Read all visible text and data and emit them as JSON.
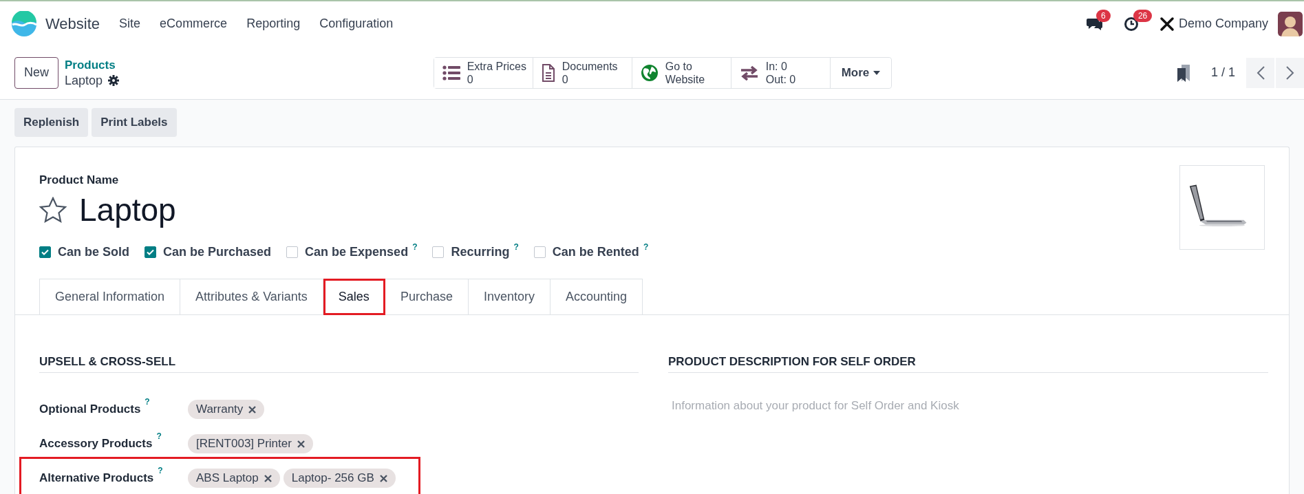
{
  "navbar": {
    "app_name": "Website",
    "menus": [
      "Site",
      "eCommerce",
      "Reporting",
      "Configuration"
    ],
    "messages_count": "6",
    "activities_count": "26",
    "company": "Demo Company"
  },
  "control_panel": {
    "new_button": "New",
    "breadcrumb": {
      "parent": "Products",
      "current": "Laptop"
    },
    "stat_buttons": [
      {
        "kind": "list",
        "lines": [
          "Extra Prices",
          "0"
        ]
      },
      {
        "kind": "document",
        "lines": [
          "Documents",
          "0"
        ]
      },
      {
        "kind": "globe",
        "lines": [
          "Go to",
          "Website"
        ]
      },
      {
        "kind": "transfer",
        "lines": [
          "In: 0",
          "Out: 0"
        ]
      }
    ],
    "more_button": "More",
    "pager": "1 / 1"
  },
  "action_buttons": [
    "Replenish",
    "Print Labels"
  ],
  "form": {
    "name_label": "Product Name",
    "name": "Laptop",
    "favorite": false,
    "options": [
      {
        "label": "Can be Sold",
        "checked": true
      },
      {
        "label": "Can be Purchased",
        "checked": true
      },
      {
        "label": "Can be Expensed",
        "checked": false,
        "help": "?"
      },
      {
        "label": "Recurring",
        "checked": false,
        "help": "?"
      },
      {
        "label": "Can be Rented",
        "checked": false,
        "help": "?"
      }
    ],
    "tabs": [
      {
        "label": "General Information",
        "selected": false,
        "highlighted": false
      },
      {
        "label": "Attributes & Variants",
        "selected": false,
        "highlighted": false
      },
      {
        "label": "Sales",
        "selected": true,
        "highlighted": true
      },
      {
        "label": "Purchase",
        "selected": false,
        "highlighted": false
      },
      {
        "label": "Inventory",
        "selected": false,
        "highlighted": false
      },
      {
        "label": "Accounting",
        "selected": false,
        "highlighted": false
      }
    ],
    "upsell": {
      "title": "UPSELL & CROSS-SELL",
      "fields": [
        {
          "label": "Optional Products",
          "help": "?",
          "tags": [
            "Warranty"
          ],
          "highlighted": false
        },
        {
          "label": "Accessory Products",
          "help": "?",
          "tags": [
            "[RENT003] Printer"
          ],
          "highlighted": false
        },
        {
          "label": "Alternative Products",
          "help": "?",
          "tags": [
            "ABS Laptop",
            "Laptop- 256 GB"
          ],
          "highlighted": true
        }
      ]
    },
    "self_order": {
      "title": "PRODUCT DESCRIPTION FOR SELF ORDER",
      "placeholder": "Information about your product for Self Order and Kiosk"
    }
  }
}
